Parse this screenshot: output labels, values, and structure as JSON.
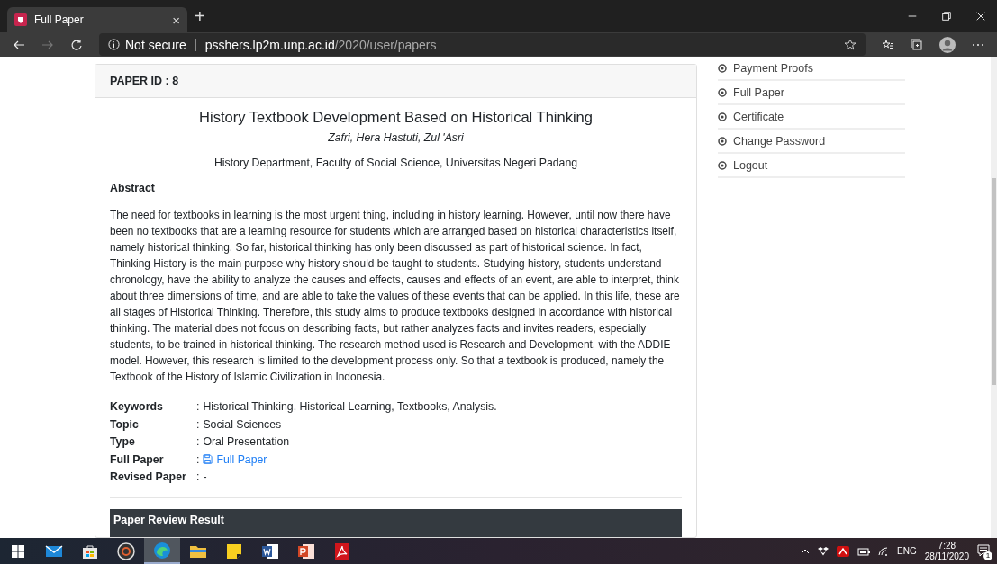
{
  "browser": {
    "tab": {
      "title": "Full Paper",
      "close": "×"
    },
    "new_tab": "+",
    "security": "Not secure",
    "url_host": "psshers.lp2m.unp.ac.id",
    "url_path": "/2020/user/papers"
  },
  "paper": {
    "header": "PAPER ID : 8",
    "title": "History Textbook Development Based on Historical Thinking",
    "authors": "Zafri, Hera Hastuti, Zul 'Asri",
    "affiliation": "History Department, Faculty of Social Science, Universitas Negeri Padang",
    "abstract_heading": "Abstract",
    "abstract": "The need for textbooks in learning is the most urgent thing, including in history learning. However, until now there have been no textbooks that are a learning resource for students which are arranged based on historical characteristics itself, namely historical thinking. So far, historical thinking has only been discussed as part of historical science. In fact, Thinking History is the main purpose why history should be taught to students. Studying history, students understand chronology, have the ability to analyze the causes and effects, causes and effects of an event, are able to interpret, think about three dimensions of time, and are able to take the values of these events that can be applied. In this life, these are all stages of Historical Thinking. Therefore, this study aims to produce textbooks designed in accordance with historical thinking. The material does not focus on describing facts, but rather analyzes facts and invites readers, especially students, to be trained in historical thinking. The research method used is Research and Development, with the ADDIE model. However, this research is limited to the development process only. So that a textbook is produced, namely the Textbook of the History of Islamic Civilization in Indonesia.",
    "details": [
      {
        "label": "Keywords",
        "separator": ":",
        "value": "Historical Thinking, Historical Learning, Textbooks, Analysis.",
        "kind": "text"
      },
      {
        "label": "Topic",
        "separator": ":",
        "value": "Social Sciences",
        "kind": "text"
      },
      {
        "label": "Type",
        "separator": ":",
        "value": "Oral Presentation",
        "kind": "text"
      },
      {
        "label": "Full Paper",
        "separator": ":",
        "value": "Full Paper",
        "kind": "link"
      },
      {
        "label": "Revised Paper",
        "separator": ":",
        "value": "-",
        "kind": "text"
      }
    ],
    "review_heading": "Paper Review Result"
  },
  "sidebar": {
    "items": [
      "Payment Proofs",
      "Full Paper",
      "Certificate",
      "Change Password",
      "Logout"
    ]
  },
  "taskbar": {
    "apps": [
      {
        "kind": "mail",
        "active": false
      },
      {
        "kind": "store",
        "active": false
      },
      {
        "kind": "media",
        "active": false
      },
      {
        "kind": "edge",
        "active": true
      },
      {
        "kind": "folder",
        "active": false
      },
      {
        "kind": "notes",
        "active": false
      },
      {
        "kind": "word",
        "active": false
      },
      {
        "kind": "powerpoint",
        "active": false
      },
      {
        "kind": "pdf",
        "active": false
      }
    ],
    "language": "ENG",
    "time": "7:28",
    "date": "28/11/2020",
    "notifications": "1"
  }
}
